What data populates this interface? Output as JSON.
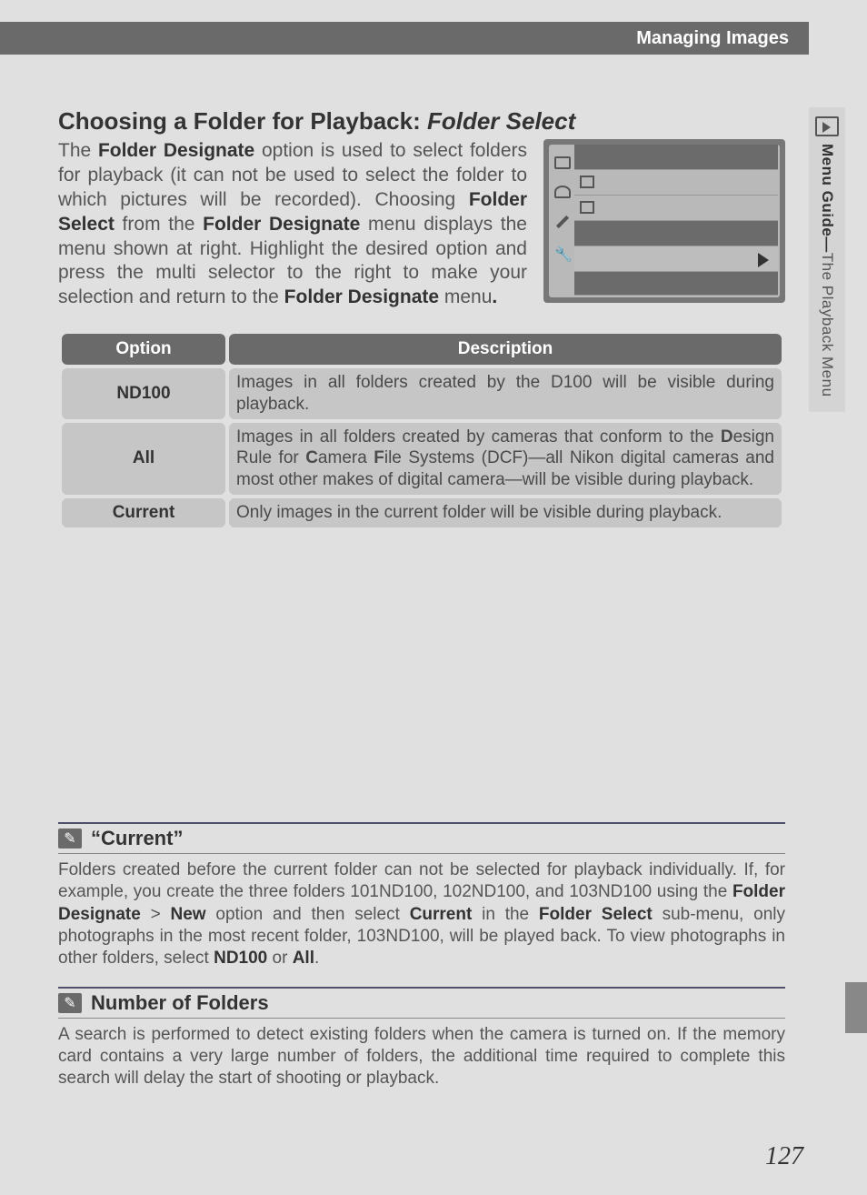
{
  "header": {
    "breadcrumb": "Managing Images"
  },
  "side_tab": {
    "label_html": "Menu Guide—The Playback Menu",
    "label_prefix_bold": "Menu Guide—",
    "label_suffix": "The Playback Menu"
  },
  "heading": {
    "plain": "Choosing a Folder for Playback: ",
    "italic": "Folder Select"
  },
  "intro": {
    "t1": "The ",
    "b1": "Folder Designate",
    "t2": " option is used to select folders for playback (it can not be used to select the folder to which pictures will be recorded). Choosing ",
    "b2": "Folder Select",
    "t3": " from the ",
    "b3": "Folder Desig­nate",
    "t4": " menu displays the menu shown at right. Highlight the desired option and press the multi selector to the right to make your selection and return to the ",
    "b4": "Folder Designate",
    "t5": " menu",
    "b5": "."
  },
  "table": {
    "head_option": "Option",
    "head_desc": "Description",
    "rows": [
      {
        "option": "ND100",
        "desc": "Images in all folders created by the D100 will be visible during playback."
      },
      {
        "option": "All",
        "desc_prefix": "Images in all folders created by cameras that conform to the ",
        "desc_b_d": "D",
        "desc_mid1": "esign Rule for ",
        "desc_b_c": "C",
        "desc_mid2": "amera ",
        "desc_b_f": "F",
        "desc_mid3": "ile Systems (DCF)—all Nikon digital cameras and most other makes of digital camera—will be visi­ble during playback."
      },
      {
        "option": "Current",
        "desc": "Only images in the current folder will be visible during play­back."
      }
    ]
  },
  "note1": {
    "title": "“Current”",
    "p1": "Folders created before the current folder can not be selected for playback individually. If, for example, you create the three folders 101ND100, 102ND100, and 103ND100 using the ",
    "b1": "Folder Designate",
    "sep": " > ",
    "b2": "New",
    "p2": " option and then select ",
    "b3": "Current",
    "p3": " in the ",
    "b4": "Folder Select",
    "p4": " sub-menu, only photographs in the most recent folder, 103ND100, will be played back.  To view photographs in other folders, select ",
    "b5": "ND100",
    "p5": " or ",
    "b6": "All",
    "p6": "."
  },
  "note2": {
    "title": "Number of Folders",
    "body": "A search is performed to detect existing folders when the camera is turned on.  If the memory card contains a very large number of folders, the additional time required to complete this search will delay the start of shooting or playback."
  },
  "page_number": "127",
  "chart_data": {
    "type": "table",
    "columns": [
      "Option",
      "Description"
    ],
    "rows": [
      [
        "ND100",
        "Images in all folders created by the D100 will be visible during playback."
      ],
      [
        "All",
        "Images in all folders created by cameras that conform to the Design Rule for Camera File Systems (DCF)—all Nikon digital cameras and most other makes of digital camera—will be visible during playback."
      ],
      [
        "Current",
        "Only images in the current folder will be visible during playback."
      ]
    ]
  }
}
